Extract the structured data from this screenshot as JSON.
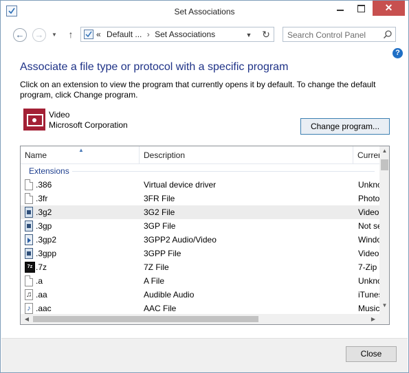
{
  "window": {
    "title": "Set Associations"
  },
  "nav": {
    "breadcrumb_prefix": "«",
    "breadcrumb_1": "Default ...",
    "breadcrumb_sep": "›",
    "breadcrumb_2": "Set Associations"
  },
  "search": {
    "placeholder": "Search Control Panel"
  },
  "content": {
    "heading": "Associate a file type or protocol with a specific program",
    "description": "Click on an extension to view the program that currently opens it by default. To change the default program, click Change program."
  },
  "current_program": {
    "name": "Video",
    "vendor": "Microsoft Corporation",
    "change_button": "Change program..."
  },
  "list": {
    "columns": {
      "name": "Name",
      "description": "Description",
      "current": "Current Default"
    },
    "group_label": "Extensions",
    "rows": [
      {
        "name": ".386",
        "description": "Virtual device driver",
        "current": "Unknown application",
        "icon": "blank-file-icon"
      },
      {
        "name": ".3fr",
        "description": "3FR File",
        "current": "Photos",
        "icon": "blank-file-icon"
      },
      {
        "name": ".3g2",
        "description": "3G2 File",
        "current": "Video",
        "icon": "video-file-icon"
      },
      {
        "name": ".3gp",
        "description": "3GP File",
        "current": "Not set",
        "icon": "video-file-icon"
      },
      {
        "name": ".3gp2",
        "description": "3GPP2 Audio/Video",
        "current": "Windows Media Player",
        "icon": "media-file-icon"
      },
      {
        "name": ".3gpp",
        "description": "3GPP File",
        "current": "Video",
        "icon": "video-file-icon"
      },
      {
        "name": ".7z",
        "description": "7Z File",
        "current": "7-Zip",
        "icon": "7z-file-icon"
      },
      {
        "name": ".a",
        "description": "A File",
        "current": "Unknown application",
        "icon": "blank-file-icon"
      },
      {
        "name": ".aa",
        "description": "Audible Audio",
        "current": "iTunes",
        "icon": "audio-file-icon"
      },
      {
        "name": ".aac",
        "description": "AAC File",
        "current": "Music",
        "icon": "music-file-icon"
      }
    ]
  },
  "footer": {
    "close_button": "Close"
  }
}
